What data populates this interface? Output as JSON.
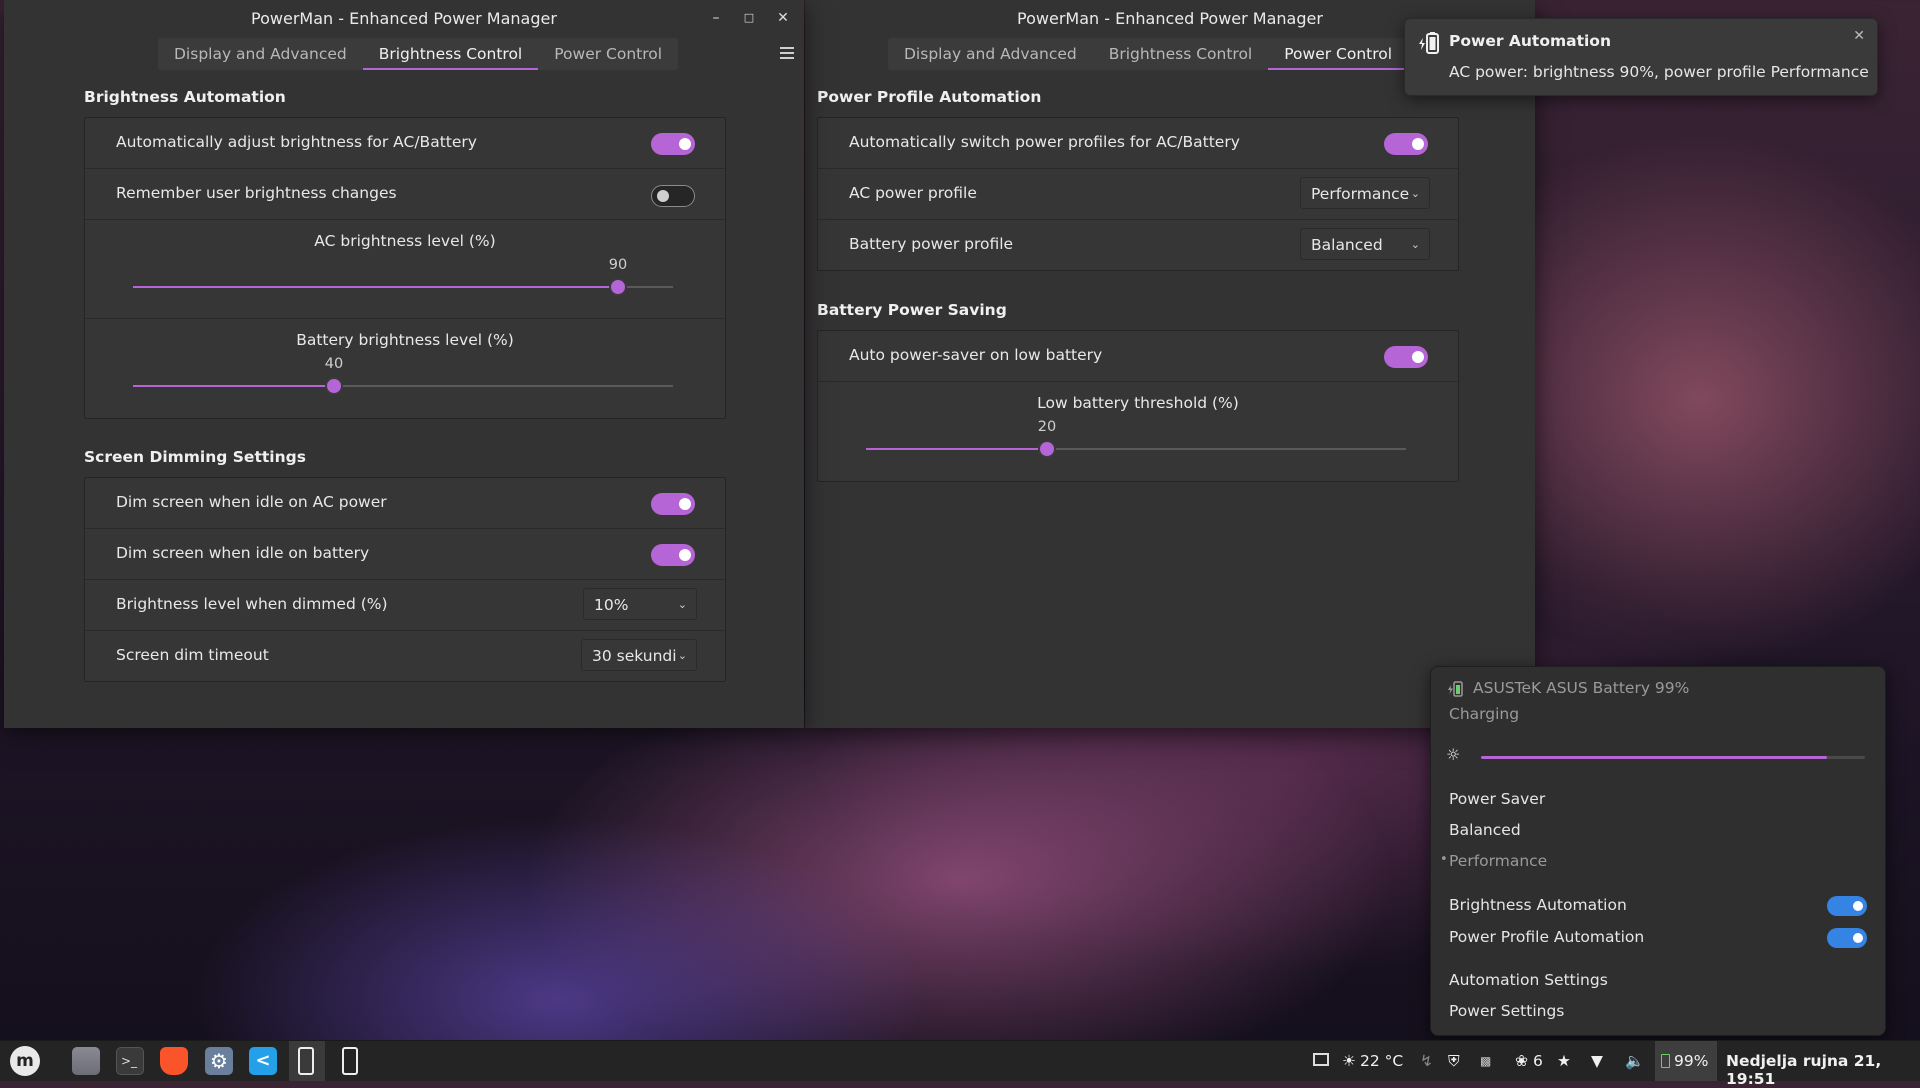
{
  "window1": {
    "title": "PowerMan - Enhanced Power Manager",
    "tabs": [
      {
        "label": "Display and Advanced",
        "active": false
      },
      {
        "label": "Brightness Control",
        "active": true
      },
      {
        "label": "Power Control",
        "active": false
      }
    ],
    "brightness_automation": {
      "title": "Brightness Automation",
      "auto_adjust_label": "Automatically adjust brightness for AC/Battery",
      "auto_adjust_on": true,
      "remember_label": "Remember user brightness changes",
      "remember_on": false,
      "ac_level_label": "AC brightness level (%)",
      "ac_level_value": "90",
      "battery_level_label": "Battery brightness level (%)",
      "battery_level_value": "40"
    },
    "screen_dimming": {
      "title": "Screen Dimming Settings",
      "dim_ac_label": "Dim screen when idle on AC power",
      "dim_ac_on": true,
      "dim_battery_label": "Dim screen when idle on battery",
      "dim_battery_on": true,
      "dim_level_label": "Brightness level when dimmed (%)",
      "dim_level_value": "10%",
      "timeout_label": "Screen dim timeout",
      "timeout_value": "30 sekundi"
    }
  },
  "window2": {
    "title": "PowerMan - Enhanced Power Manager",
    "tabs": [
      {
        "label": "Display and Advanced",
        "active": false
      },
      {
        "label": "Brightness Control",
        "active": false
      },
      {
        "label": "Power Control",
        "active": true
      }
    ],
    "power_profile": {
      "title": "Power Profile Automation",
      "auto_switch_label": "Automatically switch power profiles for AC/Battery",
      "auto_switch_on": true,
      "ac_profile_label": "AC power profile",
      "ac_profile_value": "Performance",
      "battery_profile_label": "Battery power profile",
      "battery_profile_value": "Balanced"
    },
    "battery_saving": {
      "title": "Battery Power Saving",
      "auto_saver_label": "Auto power-saver on low battery",
      "auto_saver_on": true,
      "threshold_label": "Low battery threshold (%)",
      "threshold_value": "20"
    }
  },
  "notification": {
    "title": "Power Automation",
    "body": "AC power: brightness 90%, power profile Performance",
    "icon": "battery-charging-icon"
  },
  "applet": {
    "battery_name": "ASUSTeK ASUS Battery 99%",
    "battery_status": "Charging",
    "brightness_fraction": 0.9,
    "profiles": [
      "Power Saver",
      "Balanced",
      "Performance"
    ],
    "active_profile": "Performance",
    "active_marker": "•",
    "brightness_automation_label": "Brightness Automation",
    "brightness_automation_on": true,
    "profile_automation_label": "Power Profile Automation",
    "profile_automation_on": true,
    "automation_settings_label": "Automation Settings",
    "power_settings_label": "Power Settings"
  },
  "taskbar": {
    "temperature": "22 °C",
    "notifications_count": "6",
    "battery_percent": "99%",
    "datetime": "Nedjelja rujna 21, 19:51"
  },
  "colors": {
    "accent": "#b565d6",
    "applet_toggle": "#3584e4"
  }
}
